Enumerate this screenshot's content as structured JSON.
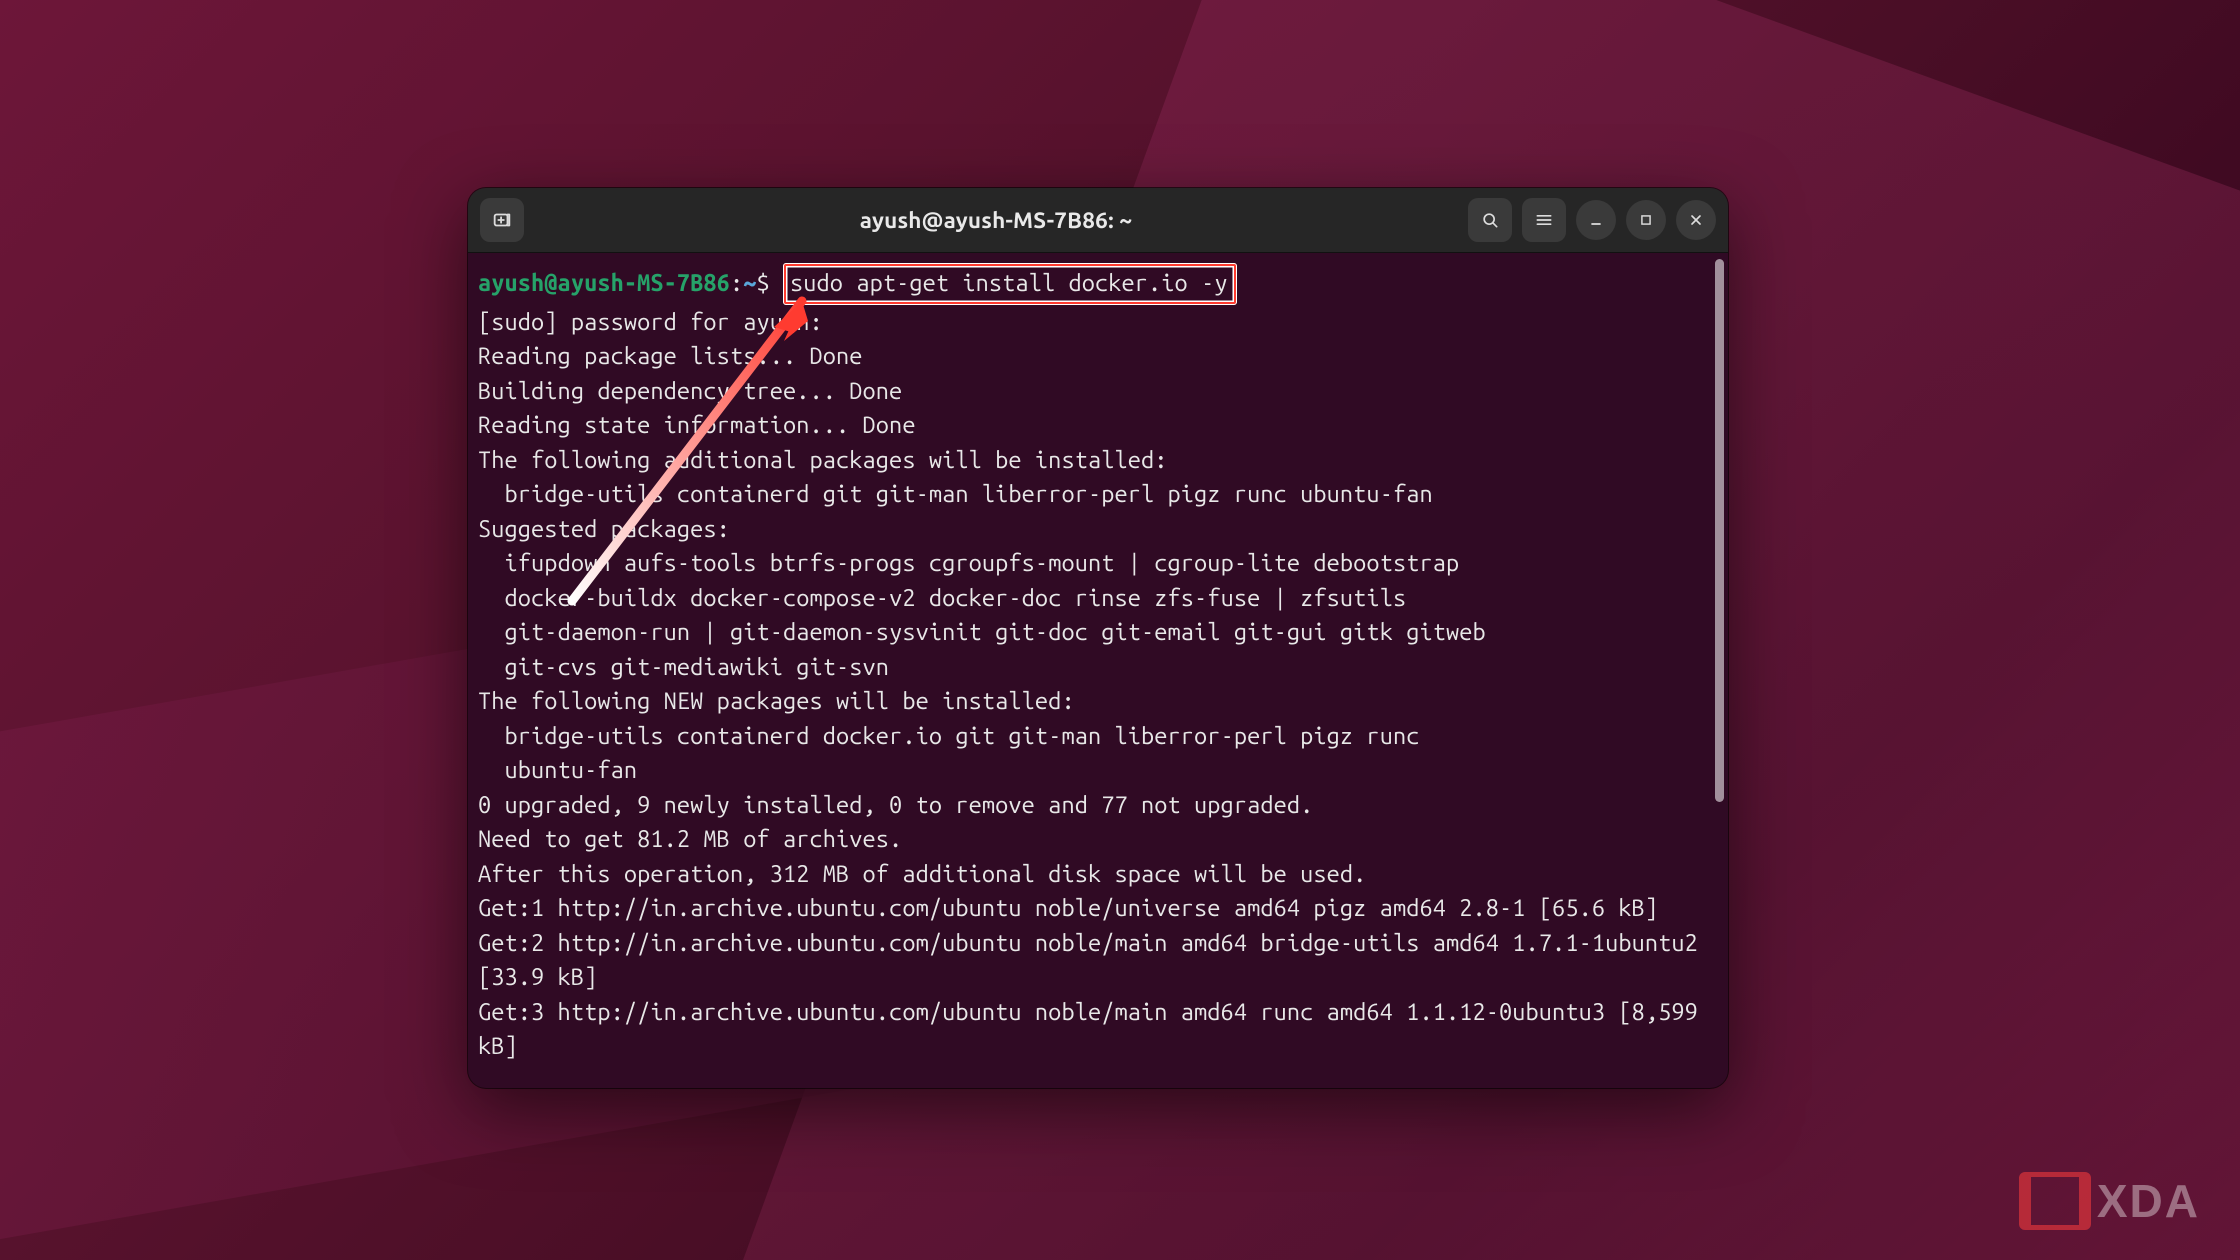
{
  "window": {
    "title": "ayush@ayush-MS-7B86: ~"
  },
  "titlebar_buttons": {
    "new_tab_label": "New tab",
    "search_label": "Search",
    "menu_label": "Menu",
    "minimize_label": "Minimize",
    "maximize_label": "Maximize",
    "close_label": "Close"
  },
  "prompt": {
    "user_host": "ayush@ayush-MS-7B86",
    "sep": ":",
    "path": "~",
    "symbol": "$"
  },
  "command": "sudo apt-get install docker.io -y",
  "output": {
    "l01": "[sudo] password for ayush:",
    "l02": "Reading package lists... Done",
    "l03": "Building dependency tree... Done",
    "l04": "Reading state information... Done",
    "l05": "The following additional packages will be installed:",
    "l06": "  bridge-utils containerd git git-man liberror-perl pigz runc ubuntu-fan",
    "l07": "Suggested packages:",
    "l08": "  ifupdown aufs-tools btrfs-progs cgroupfs-mount | cgroup-lite debootstrap",
    "l09": "  docker-buildx docker-compose-v2 docker-doc rinse zfs-fuse | zfsutils",
    "l10": "  git-daemon-run | git-daemon-sysvinit git-doc git-email git-gui gitk gitweb",
    "l11": "  git-cvs git-mediawiki git-svn",
    "l12": "The following NEW packages will be installed:",
    "l13": "  bridge-utils containerd docker.io git git-man liberror-perl pigz runc",
    "l14": "  ubuntu-fan",
    "l15": "0 upgraded, 9 newly installed, 0 to remove and 77 not upgraded.",
    "l16": "Need to get 81.2 MB of archives.",
    "l17": "After this operation, 312 MB of additional disk space will be used.",
    "l18": "Get:1 http://in.archive.ubuntu.com/ubuntu noble/universe amd64 pigz amd64 2.8-1 [65.6 kB]",
    "l19": "Get:2 http://in.archive.ubuntu.com/ubuntu noble/main amd64 bridge-utils amd64 1.7.1-1ubuntu2 [33.9 kB]",
    "l20": "Get:3 http://in.archive.ubuntu.com/ubuntu noble/main amd64 runc amd64 1.1.12-0ubuntu3 [8,599 kB]"
  },
  "watermark": {
    "text": "XDA"
  }
}
